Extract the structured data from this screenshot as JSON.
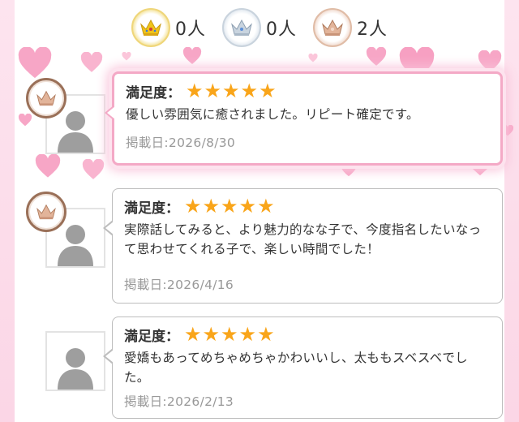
{
  "summary": {
    "gold": {
      "icon": "gold-crown-icon",
      "count": "0人"
    },
    "silver": {
      "icon": "silver-crown-icon",
      "count": "0人"
    },
    "bronze": {
      "icon": "bronze-crown-icon",
      "count": "2人"
    }
  },
  "reviews": [
    {
      "rank_icon": "bronze-crown-icon",
      "rating_label": "満足度：",
      "stars": 5,
      "comment": "優しい雰囲気に癒されました。リピート確定です。",
      "date": "掲載日:2026/8/30",
      "highlighted": true
    },
    {
      "rank_icon": "bronze-crown-icon",
      "rating_label": "満足度：",
      "stars": 5,
      "comment": "実際話してみると、より魅力的なな子で、今度指名したいなって思わせてくれる子で、楽しい時間でした！",
      "date": "掲載日:2026/4/16",
      "highlighted": false
    },
    {
      "rank_icon": null,
      "rating_label": "満足度：",
      "stars": 5,
      "comment": "愛嬌もあってめちゃめちゃかわいいし、太ももスベスベでした。",
      "date": "掲載日:2026/2/13",
      "highlighted": false
    }
  ],
  "colors": {
    "star": "#f9a51a",
    "highlight_border": "#f4a9c6",
    "side_band": "#fde4ef"
  }
}
